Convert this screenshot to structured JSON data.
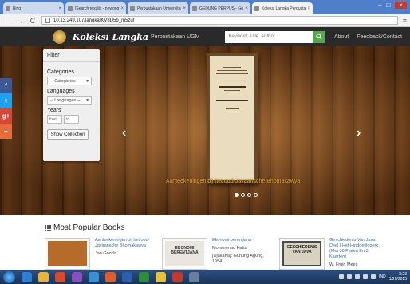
{
  "browser": {
    "tabs": [
      {
        "label": "Bing",
        "active": false
      },
      {
        "label": "[Search results - newong] ·",
        "active": false
      },
      {
        "label": "Perpustakaan Universitas ·",
        "active": false
      },
      {
        "label": "GEDUNG PERPUS - Googl",
        "active": false
      },
      {
        "label": "Koleksi Langka Perpustak",
        "active": true
      }
    ],
    "tab_close": "×",
    "url": "10.13.249.107/langka/KV8D5b_m5zuf",
    "back": "←",
    "forward": "→",
    "reload": "C",
    "menu": "≡",
    "window_controls": {
      "minimize": "–",
      "maximize": "□",
      "close": "×"
    }
  },
  "header": {
    "brand": "Koleksi Langka",
    "brand_sub": "Perpustakaan UGM",
    "search_placeholder": "Keyword, Title, Author",
    "search_icon": "search-icon",
    "nav": [
      "About",
      "Feedback/Contact"
    ]
  },
  "filter": {
    "title": "Filter",
    "categories_label": "Categories",
    "categories_value": "-- Categories --",
    "languages_label": "Languages",
    "languages_value": "-- Languages --",
    "years_label": "Years",
    "from_placeholder": "from",
    "to_placeholder": "to",
    "button": "Show Collection",
    "caret": "▾"
  },
  "social": {
    "facebook": "f",
    "twitter": "t",
    "googleplus": "g+",
    "more": "+"
  },
  "carousel": {
    "caption": "Aanteekeningen bij het oud-Javaansche Bhomakawya",
    "prev": "‹",
    "next": "›",
    "slides": 4,
    "active_slide": 1
  },
  "popular": {
    "title": "Most Popular Books",
    "books": [
      {
        "title": "Aanteekeningen bij het oud-Javaansche Bhomakawya",
        "author": "Jan Gonda",
        "extra": ""
      },
      {
        "title": "Ekonomi berentjana",
        "author": "Mohammad Hatta",
        "extra": "[Djakarta]: Gunung Agung, 1954",
        "cover_text": "EKONOMI BERENTJANA"
      },
      {
        "title": "Geschiedenis Van Java Deel I Het Hindoetijdperk (Met 30 Platen En 3 Kaarten)",
        "author": "W. Fruin Mees",
        "extra": "",
        "cover_text": "GESCHIEDENIS VAN JAVA"
      }
    ]
  },
  "taskbar": {
    "language": "IND",
    "time": "8:23",
    "date": "1/20/2015"
  },
  "colors": {
    "header_bg": "#2a2a2a",
    "search_button": "#52a84b",
    "caption": "#e8a21a",
    "link": "#3a6fb5"
  }
}
